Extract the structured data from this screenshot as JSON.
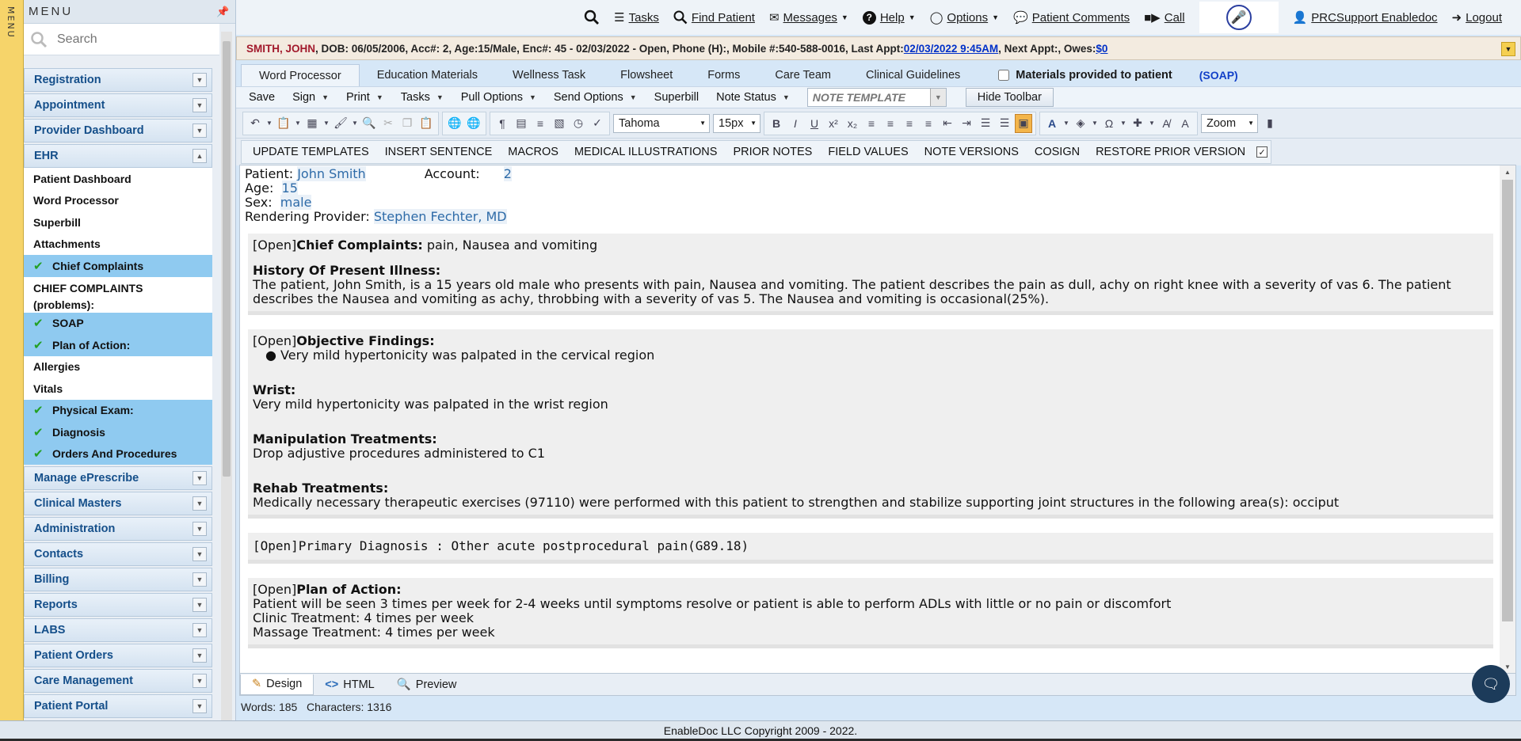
{
  "menu_strip": {
    "label": "MENU"
  },
  "sidebar": {
    "title": "MENU",
    "search_placeholder": "Search",
    "categories_top": [
      {
        "label": "Registration"
      },
      {
        "label": "Appointment"
      },
      {
        "label": "Provider Dashboard"
      },
      {
        "label": "EHR"
      }
    ],
    "ehr_items": [
      {
        "label": "Patient Dashboard",
        "selected": false,
        "checked": false
      },
      {
        "label": "Word Processor",
        "selected": false,
        "checked": false
      },
      {
        "label": "Superbill",
        "selected": false,
        "checked": false
      },
      {
        "label": "Attachments",
        "selected": false,
        "checked": false
      },
      {
        "label": "Chief Complaints",
        "selected": true,
        "checked": true
      },
      {
        "label": "CHIEF COMPLAINTS (problems):",
        "selected": false,
        "checked": false
      },
      {
        "label": "SOAP",
        "selected": true,
        "checked": true
      },
      {
        "label": "Plan of Action:",
        "selected": true,
        "checked": true
      },
      {
        "label": "Allergies",
        "selected": false,
        "checked": false
      },
      {
        "label": "Vitals",
        "selected": false,
        "checked": false
      },
      {
        "label": "Physical Exam:",
        "selected": true,
        "checked": true
      },
      {
        "label": "Diagnosis",
        "selected": true,
        "checked": true
      },
      {
        "label": "Orders And Procedures",
        "selected": true,
        "checked": true
      }
    ],
    "categories_bottom": [
      {
        "label": "Manage ePrescribe"
      },
      {
        "label": "Clinical Masters"
      },
      {
        "label": "Administration"
      },
      {
        "label": "Contacts"
      },
      {
        "label": "Billing"
      },
      {
        "label": "Reports"
      },
      {
        "label": "LABS"
      },
      {
        "label": "Patient Orders"
      },
      {
        "label": "Care Management"
      },
      {
        "label": "Patient Portal"
      }
    ]
  },
  "topbar": {
    "tasks": "Tasks",
    "find_patient": "Find Patient",
    "messages": "Messages",
    "help": "Help",
    "options": "Options",
    "patient_comments": "Patient Comments",
    "call": "Call",
    "user": "PRCSupport Enabledoc",
    "logout": "Logout"
  },
  "patient_bar": {
    "name": "SMITH, JOHN",
    "details": " , DOB: 06/05/2006, Acc#: 2, Age:15/Male, Enc#: 45 - 02/03/2022 - Open, Phone (H):, Mobile #:540-588-0016, Last Appt:",
    "last_appt": "02/03/2022 9:45AM",
    "mid": ", Next Appt:, Owes:",
    "owes": "$0"
  },
  "tabs": {
    "items": [
      "Word Processor",
      "Education Materials",
      "Wellness Task",
      "Flowsheet",
      "Forms",
      "Care Team",
      "Clinical Guidelines"
    ],
    "materials_label": "Materials provided to patient",
    "soap_label": "(SOAP)"
  },
  "menubar": {
    "save": "Save",
    "sign": "Sign",
    "print": "Print",
    "tasks": "Tasks",
    "pull_options": "Pull Options",
    "send_options": "Send Options",
    "superbill": "Superbill",
    "note_status": "Note Status",
    "note_template": "NOTE TEMPLATE",
    "hide_toolbar": "Hide Toolbar"
  },
  "toolbar": {
    "font": "Tahoma",
    "size": "15px",
    "zoom": "Zoom"
  },
  "buttonbar": [
    "UPDATE TEMPLATES",
    "INSERT SENTENCE",
    "MACROS",
    "MEDICAL ILLUSTRATIONS",
    "PRIOR NOTES",
    "FIELD VALUES",
    "NOTE VERSIONS",
    "COSIGN",
    "RESTORE PRIOR VERSION"
  ],
  "note": {
    "patient_label": "Patient:",
    "patient_value": "John Smith",
    "account_label": "Account:",
    "account_value": "2",
    "age_label": "Age:",
    "age_value": "15",
    "sex_label": "Sex:",
    "sex_value": "male",
    "provider_label": "Rendering Provider:",
    "provider_value": "Stephen Fechter, MD",
    "open_tag": "[Open]",
    "cc_title": "Chief Complaints:",
    "cc_value": " pain, Nausea and vomiting",
    "hpi_title": "History Of Present Illness:",
    "hpi_text": "The patient, John Smith, is a 15 years old male who presents with pain, Nausea and vomiting.  The patient describes the pain as dull, achy on right knee with a severity of vas 6.   The patient describes the Nausea and vomiting as achy, throbbing with a severity of vas 5. The Nausea and vomiting is occasional(25%).",
    "obj_title": "Objective Findings:",
    "obj_bullet": "Very mild hypertonicity was palpated in the cervical region",
    "wrist_title": "Wrist:",
    "wrist_text": "Very mild hypertonicity was palpated in the wrist region",
    "manip_title": "Manipulation Treatments:",
    "manip_text": "Drop adjustive procedures administered to C1",
    "rehab_title": "Rehab Treatments:",
    "rehab_text": "Medically necessary therapeutic exercises (97110) were performed with this patient to strengthen and stabilize supporting joint structures in the following area(s): occiput",
    "dx_text": "Primary Diagnosis : Other acute postprocedural pain(G89.18)",
    "plan_title": "Plan of Action:",
    "plan_line1": "Patient will be seen 3 times per week for 2-4 weeks until symptoms resolve or patient is able to perform ADLs with little or no pain or discomfort",
    "plan_line2": "Clinic Treatment: 4 times per week",
    "plan_line3": "Massage Treatment: 4 times per week"
  },
  "modes": {
    "design": "Design",
    "html": "HTML",
    "preview": "Preview"
  },
  "counts": {
    "words": "Words: 185",
    "characters": "Characters: 1316"
  },
  "footer": {
    "copyright": "EnableDoc LLC Copyright 2009 - 2022."
  }
}
